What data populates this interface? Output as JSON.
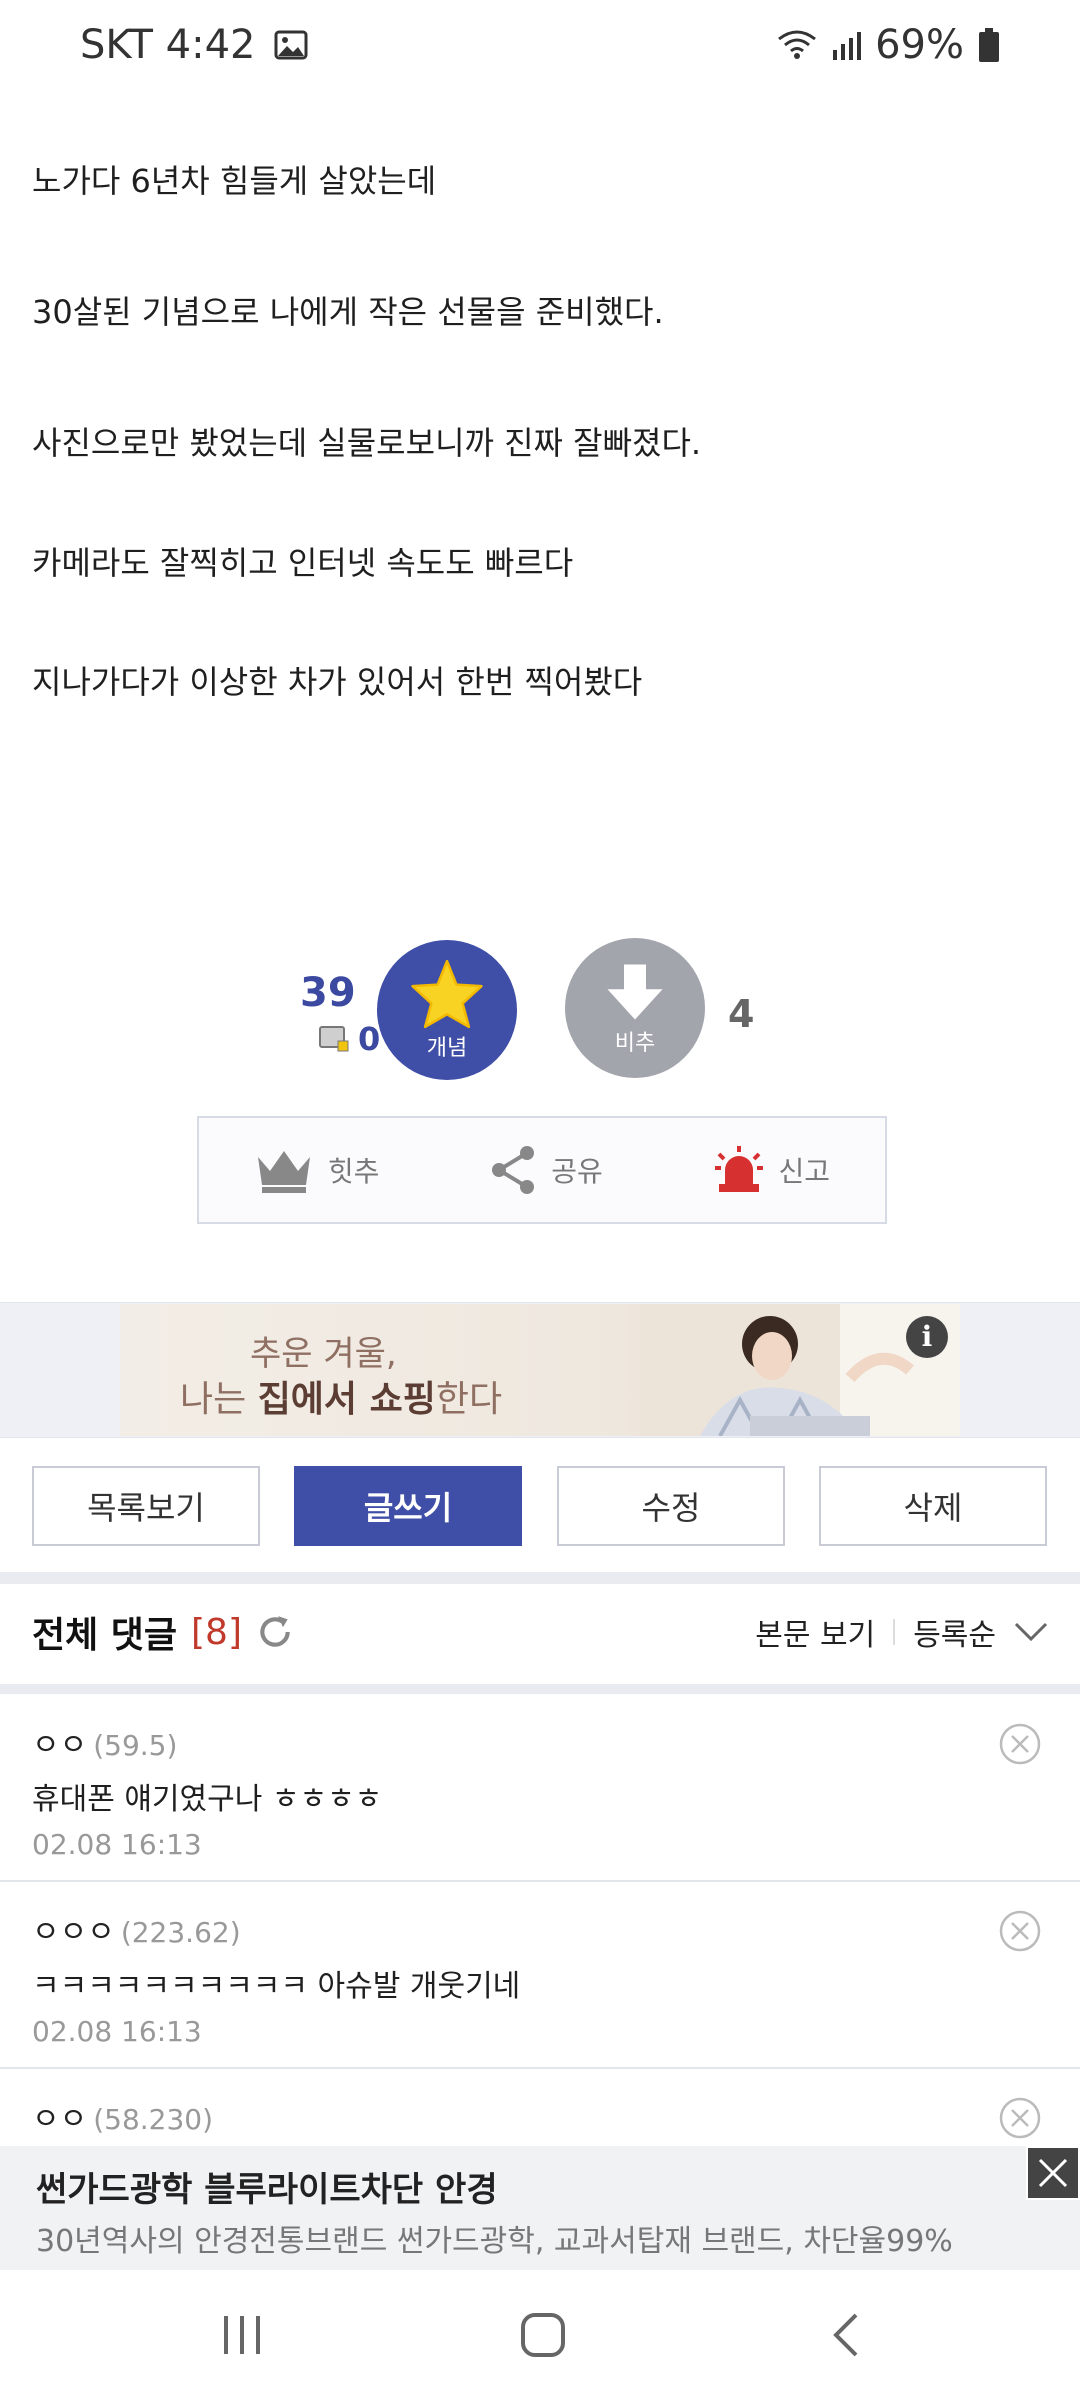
{
  "status_bar": {
    "carrier_time": "SKT 4:42",
    "battery": "69%"
  },
  "article": {
    "paragraphs": [
      "노가다 6년차 힘들게 살았는데",
      "30살된 기념으로 나에게 작은 선물을 준비했다.",
      "사진으로만 봤었는데 실물로보니까 진짜 잘빠졌다.",
      "카메라도 잘찍히고 인터넷 속도도 빠르다",
      "지나가다가 이상한 차가 있어서 한번 찍어봤다"
    ]
  },
  "votes": {
    "recommend_count": "39",
    "fixed_count": "0",
    "recommend_label": "개념",
    "nonrecommend_label": "비추",
    "nonrecommend_count": "4"
  },
  "actions": {
    "hit": "힛추",
    "share": "공유",
    "report": "신고"
  },
  "ad_banner": {
    "line1": "추운 겨울,",
    "line2_pre": "나는 ",
    "line2_bold": "집에서 쇼핑",
    "line2_post": "한다",
    "info": "i"
  },
  "buttons": {
    "list": "목록보기",
    "write": "글쓰기",
    "edit": "수정",
    "delete": "삭제"
  },
  "comments_header": {
    "title": "전체 댓글",
    "count": "[8]",
    "view_body": "본문 보기",
    "sort": "등록순"
  },
  "comments": [
    {
      "name": "ㅇㅇ",
      "ip": "(59.5)",
      "text": "휴대폰 얘기였구나 ㅎㅎㅎㅎ",
      "date": "02.08 16:13"
    },
    {
      "name": "ㅇㅇㅇ",
      "ip": "(223.62)",
      "text": "ㅋㅋㅋㅋㅋㅋㅋㅋㅋㅋ 아슈발 개웃기네",
      "date": "02.08 16:13"
    },
    {
      "name": "ㅇㅇ",
      "ip": "(58.230)",
      "text": "",
      "date": ""
    }
  ],
  "bottom_ad": {
    "title": "썬가드광학 블루라이트차단 안경",
    "desc": "30년역사의 안경전통브랜드 썬가드광학, 교과서탑재 브랜드, 차단율99%"
  },
  "colors": {
    "accent": "#3f4ea6",
    "danger": "#d63031",
    "muted": "#a3a5ad"
  }
}
